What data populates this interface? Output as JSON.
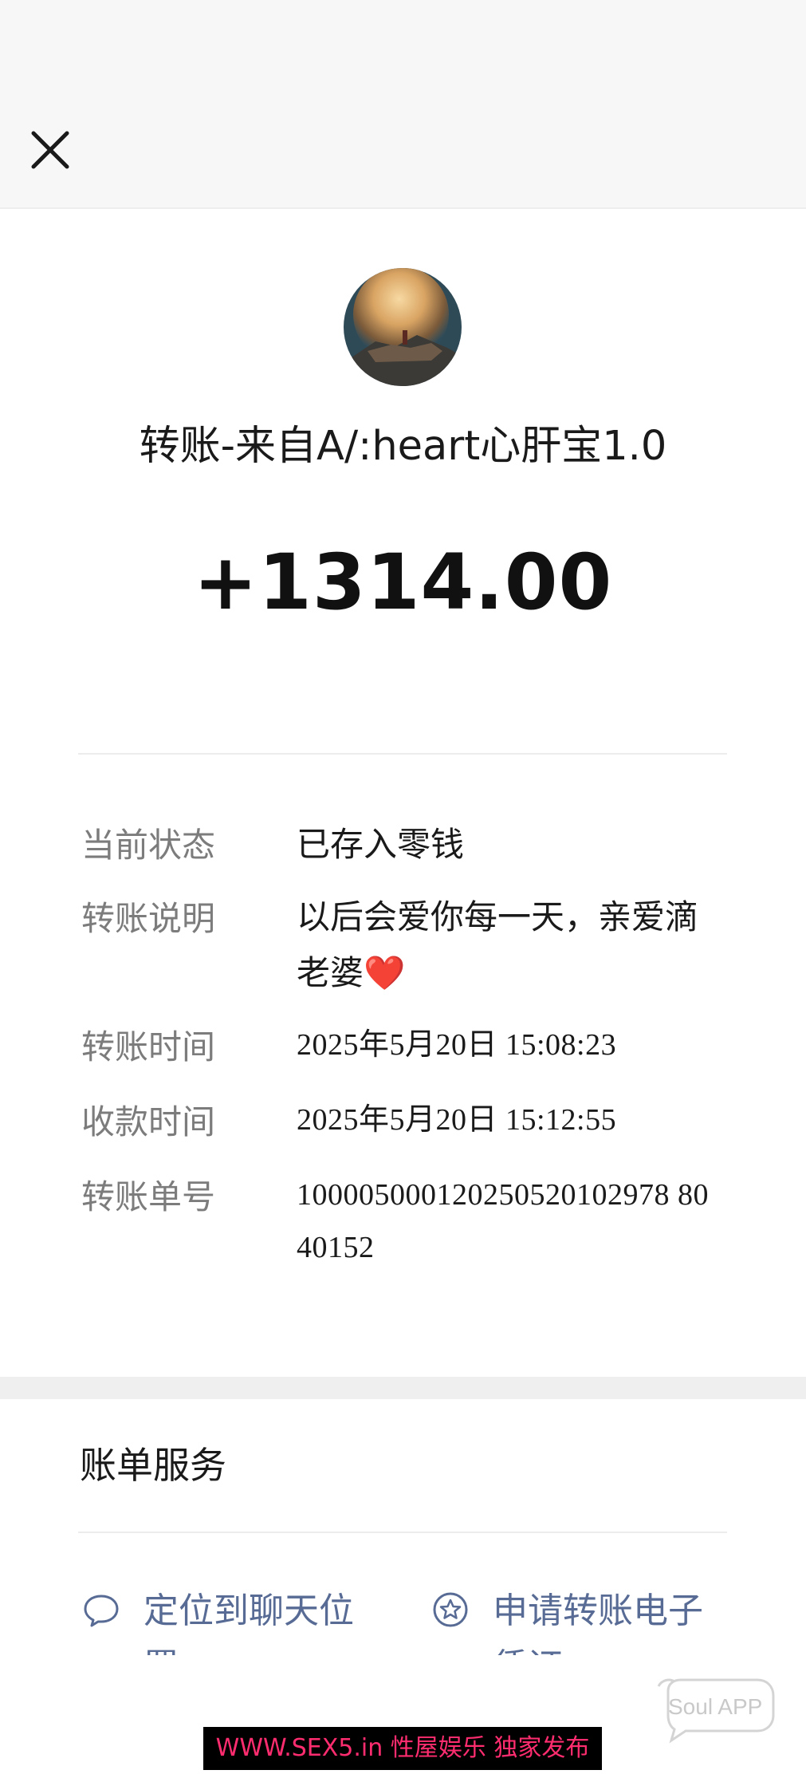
{
  "header": {
    "close_icon": "close-icon"
  },
  "transfer": {
    "title": "转账-来自A/:heart心肝宝1.0",
    "amount": "+1314.00"
  },
  "details": [
    {
      "label": "当前状态",
      "value": "已存入零钱"
    },
    {
      "label": "转账说明",
      "value": "以后会爱你每一天，亲爱滴老婆❤️"
    },
    {
      "label": "转账时间",
      "value": "2025年5月20日 15:08:23"
    },
    {
      "label": "收款时间",
      "value": "2025年5月20日 15:12:55"
    },
    {
      "label": "转账单号",
      "value": "100005000120250520102978 8040152"
    }
  ],
  "services": {
    "title": "账单服务",
    "items": [
      {
        "label": "定位到聊天位置",
        "icon": "chat-bubble-icon"
      },
      {
        "label": "申请转账电子凭证",
        "icon": "certificate-star-icon"
      }
    ]
  },
  "watermark": {
    "banner": "WWW.SEX5.in 性屋娱乐 独家发布",
    "badge": "Soul APP"
  },
  "colors": {
    "link": "#576b95",
    "label": "#7c7c7c",
    "heart": "#e23b3b"
  }
}
